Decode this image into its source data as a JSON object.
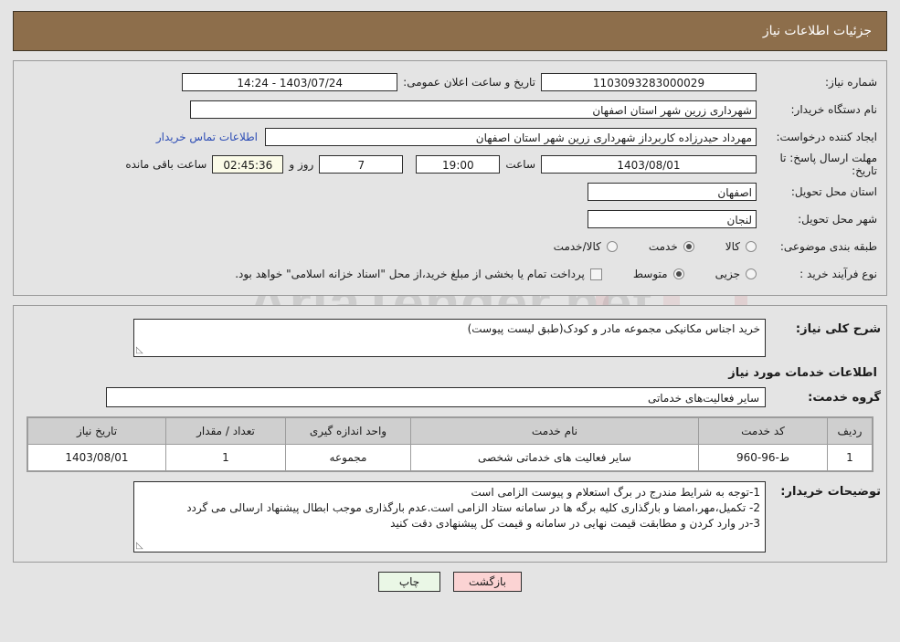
{
  "header": {
    "title": "جزئیات اطلاعات نیاز"
  },
  "watermark": {
    "text": "AriaTender.net"
  },
  "form": {
    "need_number_label": "شماره نیاز:",
    "need_number_value": "1103093283000029",
    "announce_datetime_label": "تاریخ و ساعت اعلان عمومی:",
    "announce_datetime_value": "14:24 - 1403/07/24",
    "buyer_org_label": "نام دستگاه خریدار:",
    "buyer_org_value": "شهرداری زرین شهر استان اصفهان",
    "creator_label": "ایجاد کننده درخواست:",
    "creator_value": "مهرداد حیدرزاده کاربرداز شهرداری زرین شهر استان اصفهان",
    "contact_link": "اطلاعات تماس خریدار",
    "deadline_label": "مهلت ارسال پاسخ: تا تاریخ:",
    "deadline_date": "1403/08/01",
    "deadline_time_label": "ساعت",
    "deadline_time": "19:00",
    "remaining_days": "7",
    "days_and_label": "روز و",
    "remaining_clock": "02:45:36",
    "remaining_suffix": "ساعت باقی مانده",
    "province_label": "استان محل تحویل:",
    "province_value": "اصفهان",
    "city_label": "شهر محل تحویل:",
    "city_value": "لنجان",
    "category_label": "طبقه بندی موضوعی:",
    "category_options": [
      {
        "label": "کالا",
        "selected": false
      },
      {
        "label": "خدمت",
        "selected": true
      },
      {
        "label": "کالا/خدمت",
        "selected": false
      }
    ],
    "process_label": "نوع فرآیند خرید :",
    "process_options": [
      {
        "label": "جزیی",
        "selected": false
      },
      {
        "label": "متوسط",
        "selected": true
      }
    ],
    "treasury_checkbox_checked": false,
    "treasury_note": "پرداخت تمام یا بخشی از مبلغ خرید،از محل \"اسناد خزانه اسلامی\" خواهد بود."
  },
  "details": {
    "need_desc_label": "شرح کلی نیاز:",
    "need_desc_value": "خرید اجناس مکانیکی مجموعه مادر و کودک(طبق لیست پیوست)",
    "services_section_title": "اطلاعات خدمات مورد نیاز",
    "service_group_label": "گروه خدمت:",
    "service_group_value": "سایر فعالیت‌های خدماتی"
  },
  "table": {
    "columns": [
      "ردیف",
      "کد خدمت",
      "نام خدمت",
      "واحد اندازه گیری",
      "تعداد / مقدار",
      "تاریخ نیاز"
    ],
    "rows": [
      {
        "radif": "1",
        "code": "ط-96-960",
        "name": "سایر فعالیت های خدماتی شخصی",
        "unit": "مجموعه",
        "qty": "1",
        "date": "1403/08/01"
      }
    ]
  },
  "notes": {
    "label": "توضیحات خریدار:",
    "lines": [
      "1-توجه به شرایط مندرج در برگ استعلام و پیوست الزامی است",
      "2- تکمیل،مهر،امضا و بارگذاری کلیه برگه ها در سامانه ستاد الزامی است.عدم بارگذاری موجب ابطال پیشنهاد ارسالی می گردد",
      "3-در وارد کردن و مطابقت قیمت نهایی در سامانه و قیمت کل پیشنهادی دقت کنید"
    ]
  },
  "footer": {
    "print_label": "چاپ",
    "back_label": "بازگشت"
  },
  "colors": {
    "header_bg": "#8d6e4b",
    "page_bg": "#e4e4e4",
    "link": "#2d4db5",
    "print_btn": "#eaf7e6",
    "back_btn": "#fbd3d3",
    "countdown_bg": "#fbfbe8"
  }
}
